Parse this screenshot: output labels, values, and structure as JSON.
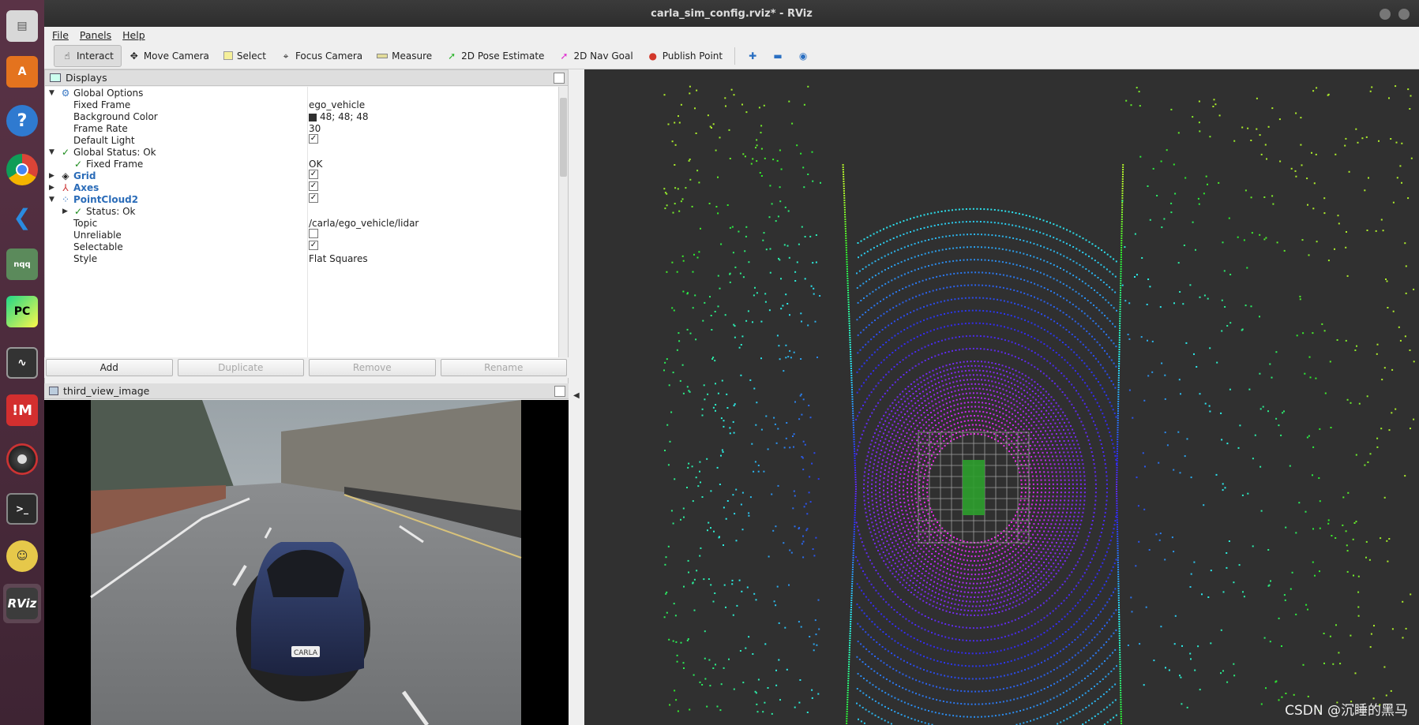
{
  "window": {
    "title": "carla_sim_config.rviz* - RViz"
  },
  "menu": [
    "File",
    "Panels",
    "Help"
  ],
  "toolbar": {
    "tools": [
      {
        "label": "Interact",
        "icon": "hand-icon"
      },
      {
        "label": "Move Camera",
        "icon": "move-icon"
      },
      {
        "label": "Select",
        "icon": "select-box-icon"
      },
      {
        "label": "Focus Camera",
        "icon": "crosshair-icon"
      },
      {
        "label": "Measure",
        "icon": "ruler-icon"
      },
      {
        "label": "2D Pose Estimate",
        "icon": "green-arrow-icon"
      },
      {
        "label": "2D Nav Goal",
        "icon": "magenta-arrow-icon"
      },
      {
        "label": "Publish Point",
        "icon": "pin-icon"
      }
    ],
    "icons": [
      "plus-icon",
      "minus-icon",
      "eye-icon"
    ]
  },
  "displays": {
    "title": "Displays",
    "rows": [
      {
        "label": "Global Options",
        "value": ""
      },
      {
        "label": "Fixed Frame",
        "value": "ego_vehicle"
      },
      {
        "label": "Background Color",
        "value": "48; 48; 48"
      },
      {
        "label": "Frame Rate",
        "value": "30"
      },
      {
        "label": "Default Light",
        "value": ""
      },
      {
        "label": "Global Status: Ok",
        "value": ""
      },
      {
        "label": "Fixed Frame",
        "value": "OK"
      },
      {
        "label": "Grid",
        "value": ""
      },
      {
        "label": "Axes",
        "value": ""
      },
      {
        "label": "PointCloud2",
        "value": ""
      },
      {
        "label": "Status: Ok",
        "value": ""
      },
      {
        "label": "Topic",
        "value": "/carla/ego_vehicle/lidar"
      },
      {
        "label": "Unreliable",
        "value": ""
      },
      {
        "label": "Selectable",
        "value": ""
      },
      {
        "label": "Style",
        "value": "Flat Squares"
      }
    ],
    "buttons": {
      "add": "Add",
      "duplicate": "Duplicate",
      "remove": "Remove",
      "rename": "Rename"
    }
  },
  "image_panel": {
    "title": "third_view_image",
    "plate": "CARLA"
  },
  "watermark": "CSDN @沉睡的黑马",
  "colors": {
    "background": "#303030",
    "panel": "#efefef",
    "accent_blue": "#2b6cb8"
  }
}
